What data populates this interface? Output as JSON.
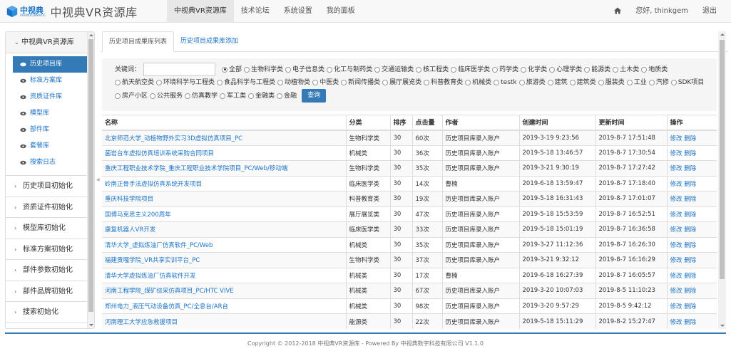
{
  "brand": {
    "logo_cn": "中视典",
    "logo_en": "VRPINFORMATIC",
    "site_title": "中视典VR资源库"
  },
  "nav": {
    "items": [
      "中视典VR资源库",
      "技术论坛",
      "系统设置",
      "我的面板"
    ],
    "greeting": "您好, thinkgem",
    "logout": "退出"
  },
  "sidebar": {
    "group": "中视典VR资源库",
    "items": [
      "历史项目库",
      "标准方案库",
      "资质证件库",
      "模型库",
      "部件库",
      "套餐库",
      "搜索日志"
    ],
    "collapsed": [
      "历史项目初始化",
      "资质证件初始化",
      "模型库初始化",
      "标准方案初始化",
      "部件参数初始化",
      "部件品牌初始化",
      "搜索初始化"
    ]
  },
  "tabs": [
    "历史项目成果库列表",
    "历史项目成果库添加"
  ],
  "search": {
    "label": "关键词：",
    "query_button": "查询",
    "options": [
      "全部",
      "生物科学类",
      "电子信息类",
      "化工与制药类",
      "交通运输类",
      "核工程类",
      "临床医学类",
      "药学类",
      "化学类",
      "心理学类",
      "能源类",
      "土木类",
      "地质类",
      "航天航空类",
      "环境科学与工程类",
      "食品科学与工程类",
      "动植物类",
      "中医类",
      "新闻传播类",
      "展厅展览类",
      "科普教育类",
      "机械类",
      "testk",
      "旅游类",
      "建筑",
      "建筑类",
      "服装类",
      "工业",
      "汽修",
      "SDK项目",
      "房产小区",
      "公共服务",
      "仿真教学",
      "军工类",
      "金融类",
      "金融"
    ],
    "selected": "全部"
  },
  "table": {
    "headers": [
      "名称",
      "分类",
      "排序",
      "点击量",
      "作者",
      "创建时间",
      "更新时间",
      "操作"
    ],
    "edit": "修改",
    "delete": "删除",
    "rows": [
      [
        "北京师范大学_动植物野外实习3D虚拟仿真项目_PC",
        "生物科学类",
        "30",
        "60次",
        "历史项目库录入账户",
        "2019-3-19 9:23:56",
        "2019-8-7 17:51:48"
      ],
      [
        "菌岩台车虚拟仿真培训系统采购合同项目",
        "机械类",
        "30",
        "36次",
        "历史项目库录入账户",
        "2019-5-18 13:46:57",
        "2019-8-7 17:30:54"
      ],
      [
        "重庆工程职业技术学院_重庆工程职业技术学院项目_PC/Web/移动端",
        "生物科学类",
        "30",
        "35次",
        "历史项目库录入账户",
        "2019-3-21 9:30:19",
        "2019-8-7 17:27:42"
      ],
      [
        "岭南正骨手法虚拟仿真系统开发项目",
        "临床医学类",
        "30",
        "14次",
        "曹楠",
        "2019-6-18 13:59:47",
        "2019-8-7 17:18:40"
      ],
      [
        "重庆科技学院项目",
        "科普教育类",
        "30",
        "19次",
        "历史项目库录入账户",
        "2019-5-18 16:31:43",
        "2019-8-7 17:01:07"
      ],
      [
        "国博马克思主义200周年",
        "展厅展览类",
        "30",
        "47次",
        "历史项目库录入账户",
        "2019-5-18 15:53:59",
        "2019-8-7 16:52:51"
      ],
      [
        "康复机器人VR开发",
        "临床医学类",
        "30",
        "33次",
        "历史项目库录入账户",
        "2019-5-18 15:01:19",
        "2019-8-7 16:36:58"
      ],
      [
        "清华大学_虚拟炼油厂仿真软件_PC/Web",
        "机械类",
        "30",
        "35次",
        "历史项目库录入账户",
        "2019-3-27 11:12:36",
        "2019-8-7 16:26:30"
      ],
      [
        "福建贡嘎学院_VR共享实训平台_PC",
        "生物科学类",
        "30",
        "37次",
        "历史项目库录入账户",
        "2019-3-21 9:32:12",
        "2019-8-7 16:16:29"
      ],
      [
        "清华大学虚拟炼油厂仿真软件开发",
        "机械类",
        "30",
        "17次",
        "曹楠",
        "2019-6-18 16:27:39",
        "2019-8-7 16:05:57"
      ],
      [
        "河南工程学院_煤矿综采仿真项目_PC/HTC VIVE",
        "机械类",
        "30",
        "67次",
        "历史项目库录入账户",
        "2019-3-20 10:07:03",
        "2019-8-5 11:10:23"
      ],
      [
        "郑州电力_液压气动设备仿真_PC/全息台/AR台",
        "机械类",
        "30",
        "98次",
        "历史项目库录入账户",
        "2019-3-20 9:57:29",
        "2019-8-5 9:42:12"
      ],
      [
        "河南理工大学应急救援项目",
        "能源类",
        "30",
        "22次",
        "历史项目库录入账户",
        "2019-5-18 15:11:29",
        "2019-8-2 15:27:47"
      ]
    ]
  },
  "footer": "Copyright © 2012-2018 中视典VR资源库 - Powered By 中视典数字科技有限公司 V1.1.0",
  "colors": {
    "primary": "#337ab7",
    "link": "#1a73c8"
  }
}
